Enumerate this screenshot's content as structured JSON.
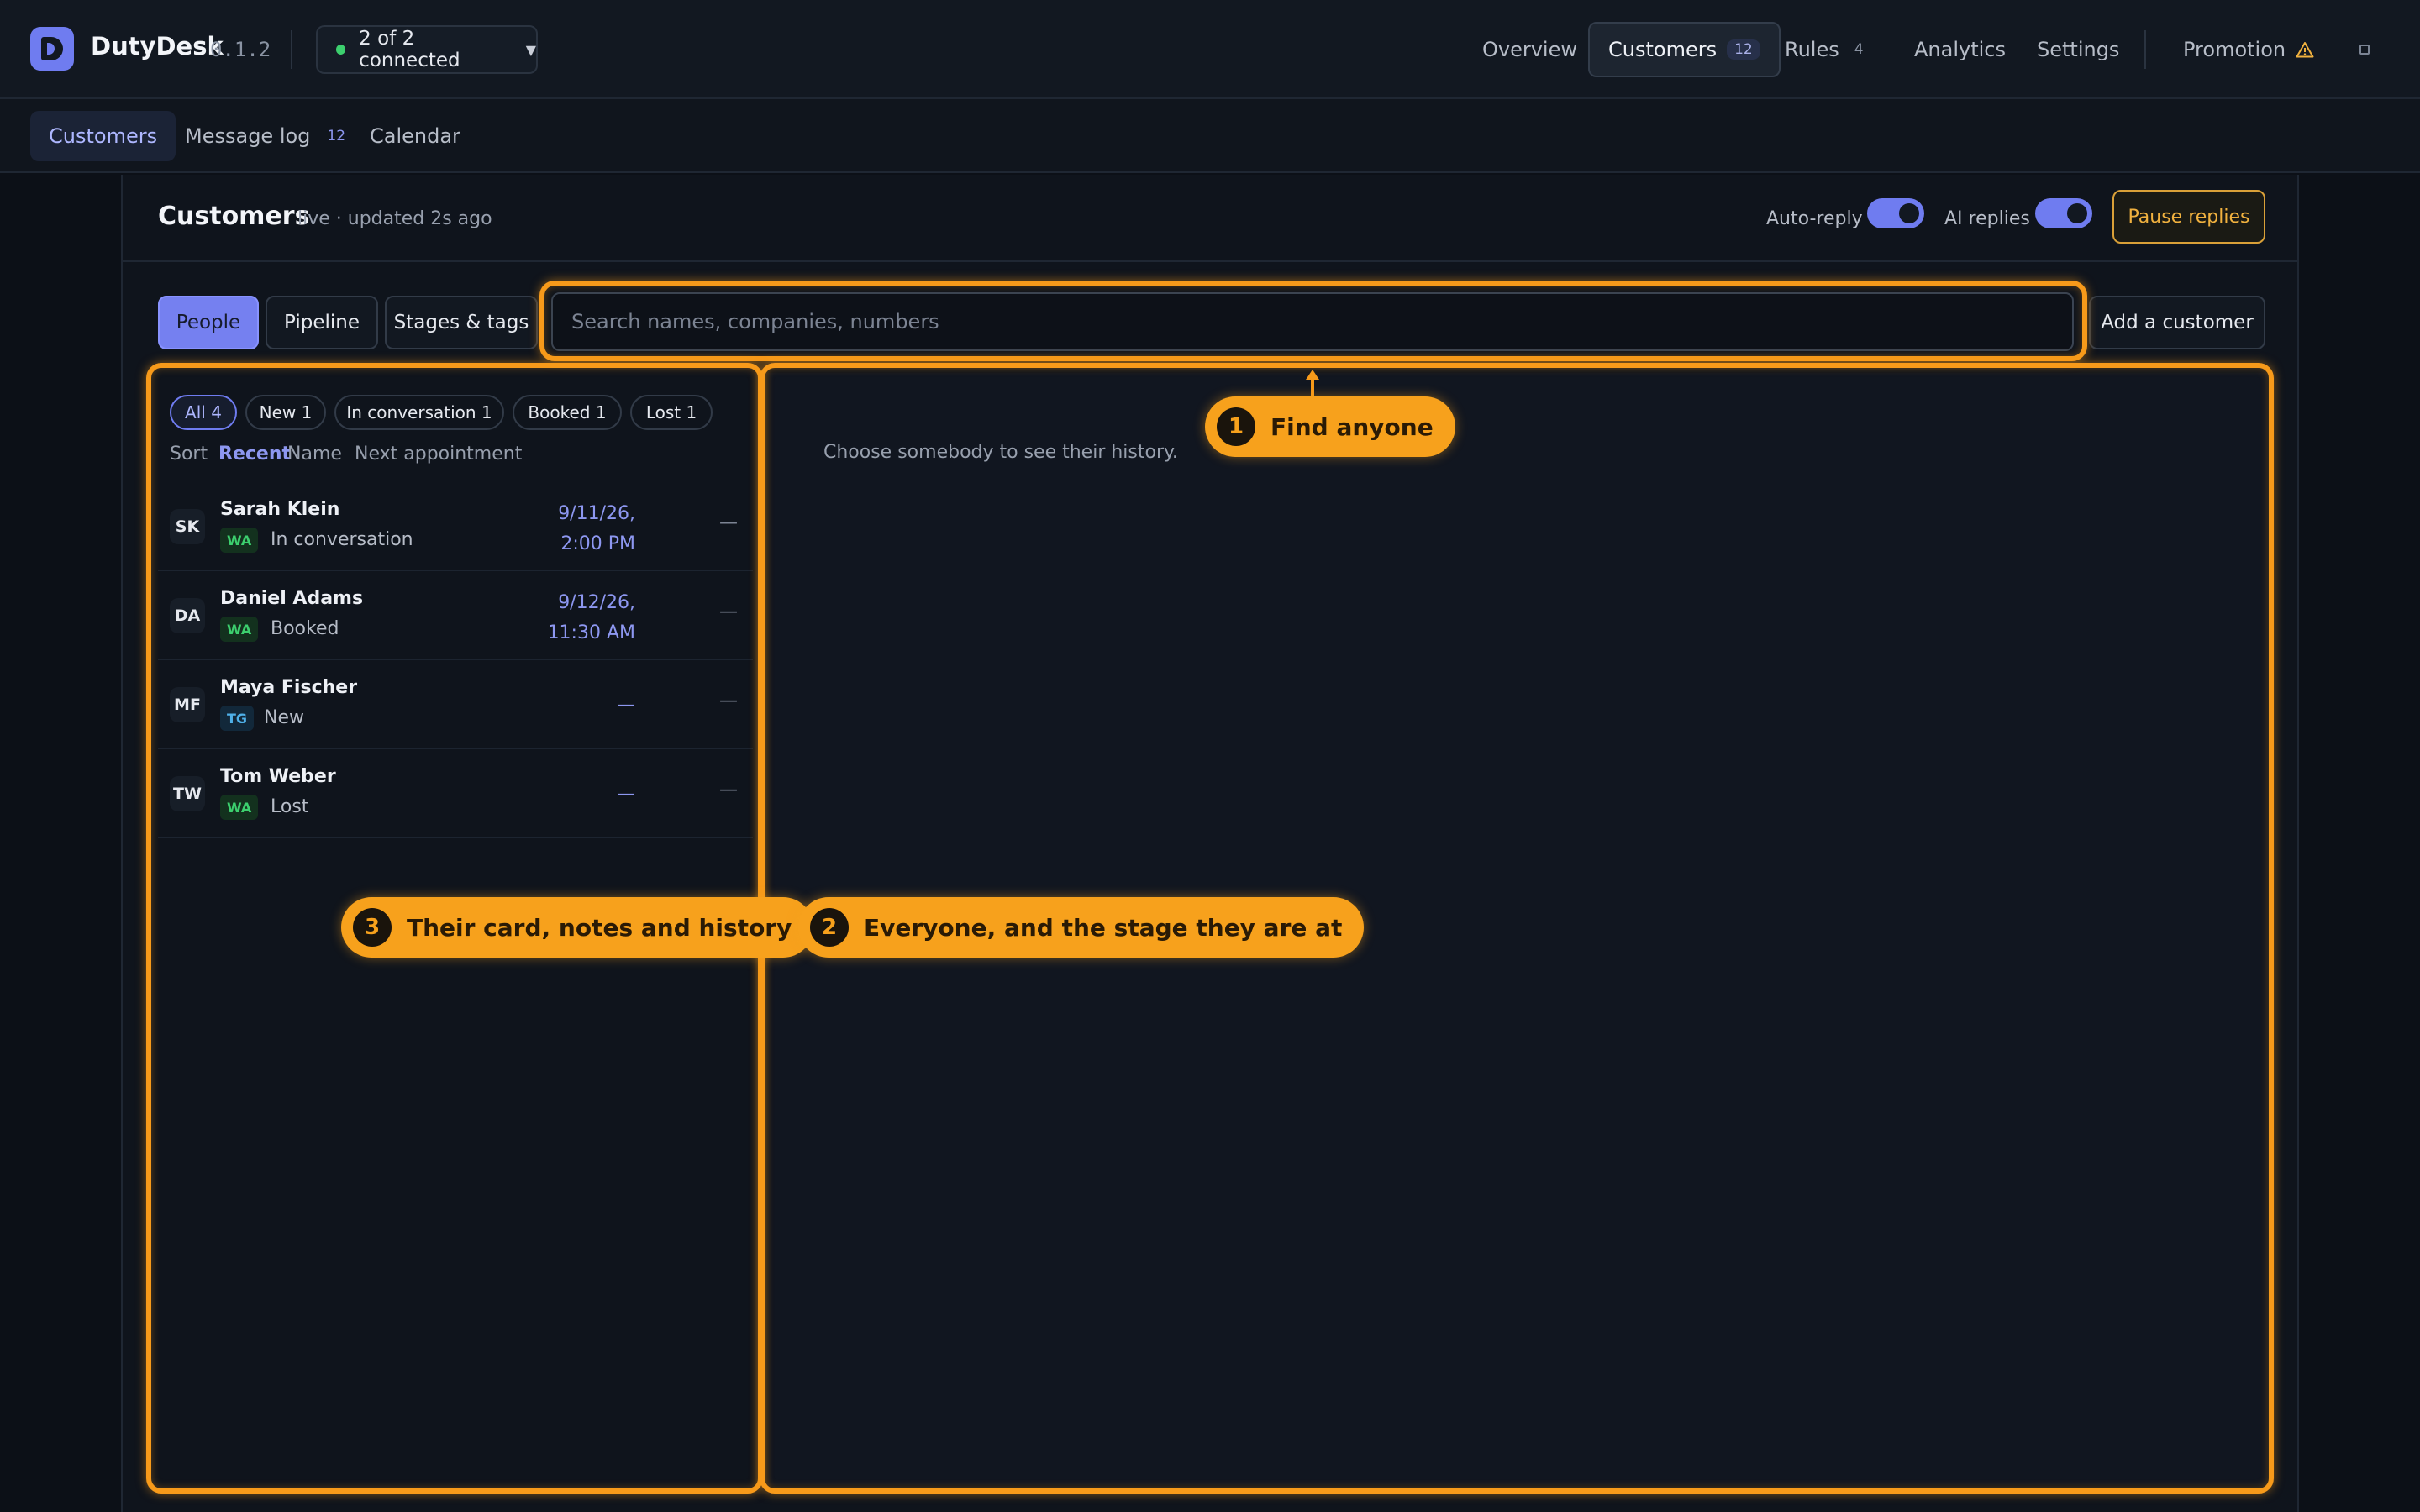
{
  "app": {
    "name": "DutyDesk",
    "version": "0.1.2"
  },
  "connection": {
    "label": "2 of 2 connected"
  },
  "nav": {
    "overview": "Overview",
    "customers": "Customers",
    "customers_badge": "12",
    "rules": "Rules",
    "rules_count": "4",
    "analytics": "Analytics",
    "settings": "Settings",
    "promotion": "Promotion"
  },
  "subnav": {
    "customers": "Customers",
    "message_log": "Message log",
    "message_log_badge": "12",
    "calendar": "Calendar"
  },
  "page": {
    "title": "Customers",
    "status": "live · updated 2s ago",
    "auto_reply_label": "Auto-reply",
    "ai_replies_label": "AI replies",
    "pause_label": "Pause replies"
  },
  "toggles": {
    "auto_reply": true,
    "ai_replies": true
  },
  "views": {
    "people": "People",
    "pipeline": "Pipeline",
    "stages_tags": "Stages & tags"
  },
  "search": {
    "placeholder": "Search names, companies, numbers",
    "value": ""
  },
  "add_customer": "Add a customer",
  "filters": [
    "All 4",
    "New 1",
    "In conversation 1",
    "Booked 1",
    "Lost 1"
  ],
  "sort": {
    "label": "Sort",
    "options": [
      "Recent",
      "Name",
      "Next appointment"
    ],
    "selected": "Recent"
  },
  "customers": [
    {
      "initials": "SK",
      "name": "Sarah Klein",
      "channel": "WA",
      "stage": "In conversation",
      "appt_date": "9/11/26,",
      "appt_time": "2:00 PM",
      "last": "—"
    },
    {
      "initials": "DA",
      "name": "Daniel Adams",
      "channel": "WA",
      "stage": "Booked",
      "appt_date": "9/12/26,",
      "appt_time": "11:30 AM",
      "last": "—"
    },
    {
      "initials": "MF",
      "name": "Maya Fischer",
      "channel": "TG",
      "stage": "New",
      "appt_date": "—",
      "appt_time": "",
      "last": "—"
    },
    {
      "initials": "TW",
      "name": "Tom Weber",
      "channel": "WA",
      "stage": "Lost",
      "appt_date": "—",
      "appt_time": "",
      "last": "—"
    }
  ],
  "detail": {
    "empty": "Choose somebody to see their history."
  },
  "callouts": [
    {
      "num": "1",
      "text": "Find anyone"
    },
    {
      "num": "2",
      "text": "Everyone, and the stage they are at"
    },
    {
      "num": "3",
      "text": "Their card, notes and history"
    }
  ],
  "colors": {
    "accent": "#6f7cf0",
    "highlight": "#f79a1a",
    "whatsapp": "#3ccf6e",
    "telegram": "#4fb0e8",
    "warning": "#f0b13f"
  }
}
